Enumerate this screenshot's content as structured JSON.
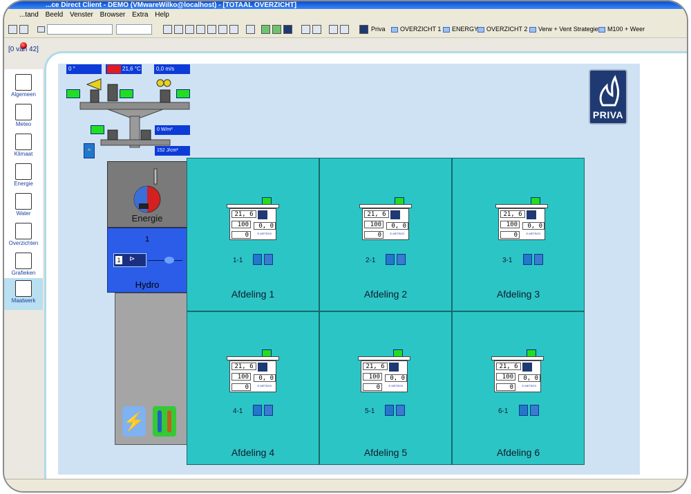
{
  "window": {
    "title": "...ce Direct Client - DEMO (VMwareWilko@localhost) - [TOTAAL OVERZICHT]"
  },
  "menubar": {
    "items": [
      "...tand",
      "Beeld",
      "Venster",
      "Browser",
      "Extra",
      "Help"
    ]
  },
  "toolbar": {
    "links": [
      "Priva",
      "OVERZICHT 1",
      "ENERGY",
      "OVERZICHT 2",
      "Verw + Vent Strategie",
      "M100 + Weer"
    ]
  },
  "status": {
    "counter": "[0 van 42]"
  },
  "sidebar": {
    "items": [
      {
        "label": "Algemeen",
        "icon": "notes-icon"
      },
      {
        "label": "Meteo",
        "icon": "cloud-icon"
      },
      {
        "label": "Klimaat",
        "icon": "sun-icon"
      },
      {
        "label": "Energie",
        "icon": "energy-graph-icon"
      },
      {
        "label": "Water",
        "icon": "water-drop-icon"
      },
      {
        "label": "Overzichten",
        "icon": "overview-icon"
      },
      {
        "label": "Grafieken",
        "icon": "chart-icon"
      },
      {
        "label": "Maatwerk",
        "icon": "pencil-icon"
      }
    ]
  },
  "weather": {
    "wind_direction": "0 °",
    "temperature": "21,6 °C",
    "wind_speed": "0,0 m/s",
    "radiation": "0 W/m²",
    "radiation_sum": "152 J/cm²"
  },
  "energy": {
    "label": "Energie"
  },
  "hydro": {
    "number": "1",
    "pump_number": "1",
    "label": "Hydro"
  },
  "brand": {
    "name": "PRIVA"
  },
  "departments": [
    {
      "title": "Afdeling 1",
      "sub": "1-1",
      "temp": "21, 6",
      "val1": "100",
      "val2": "0, 0",
      "val3": "0",
      "meetbox": "E-METBOX"
    },
    {
      "title": "Afdeling 2",
      "sub": "2-1",
      "temp": "21, 6",
      "val1": "100",
      "val2": "0, 0",
      "val3": "0",
      "meetbox": "E-METBOX"
    },
    {
      "title": "Afdeling 3",
      "sub": "3-1",
      "temp": "21, 6",
      "val1": "100",
      "val2": "0, 0",
      "val3": "0",
      "meetbox": "E-METBOX"
    },
    {
      "title": "Afdeling 4",
      "sub": "4-1",
      "temp": "21, 6",
      "val1": "100",
      "val2": "0, 0",
      "val3": "0",
      "meetbox": "E-METBOX"
    },
    {
      "title": "Afdeling 5",
      "sub": "5-1",
      "temp": "21, 6",
      "val1": "100",
      "val2": "0, 0",
      "val3": "0",
      "meetbox": "E-METBOX"
    },
    {
      "title": "Afdeling 6",
      "sub": "6-1",
      "temp": "21, 6",
      "val1": "100",
      "val2": "0, 0",
      "val3": "0",
      "meetbox": "E-METBOX"
    }
  ],
  "colors": {
    "cell_bg": "#2cc5c5",
    "info_box": "#0d3bd8",
    "indicator_green": "#22dd22",
    "energy_panel": "#7a7a7a",
    "hydro_panel": "#2b5de8",
    "canvas_bg": "#cfe2f4"
  }
}
